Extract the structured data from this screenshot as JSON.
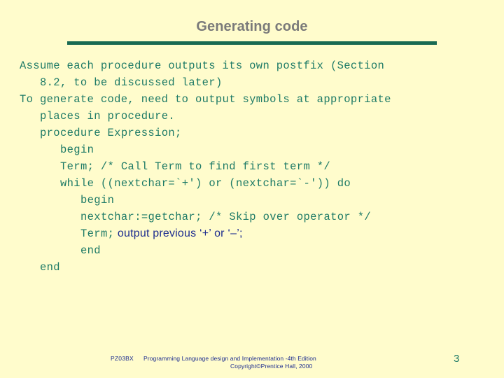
{
  "slide": {
    "title": "Generating code",
    "page_number": "3",
    "background_color": "#fffccc",
    "title_color": "#7a7a7a",
    "rule_color": "#186a52",
    "code_color": "#1d7a66",
    "accent_color": "#1d2d8f"
  },
  "body": {
    "lines": [
      {
        "indent": 0,
        "text": "Assume each procedure outputs its own postfix (Section"
      },
      {
        "indent": 1,
        "text": "8.2, to be discussed later)"
      },
      {
        "indent": 0,
        "text": "To generate code, need to output symbols at appropriate"
      },
      {
        "indent": 1,
        "text": "places in procedure."
      },
      {
        "indent": 1,
        "text": "procedure Expression;"
      },
      {
        "indent": 2,
        "text": "begin"
      },
      {
        "indent": 2,
        "text": "Term; /* Call Term to find first term */"
      },
      {
        "indent": 2,
        "text": "while ((nextchar=`+') or (nextchar=`-')) do"
      },
      {
        "indent": 3,
        "text": "begin"
      },
      {
        "indent": 3,
        "text": "nextchar:=getchar; /* Skip over operator */"
      },
      {
        "indent": 3,
        "text": "Term;",
        "text2": " output previous ‘+’ or ‘–’;"
      },
      {
        "indent": 3,
        "text": "end"
      },
      {
        "indent": 1,
        "text": "end"
      }
    ]
  },
  "footer": {
    "code": "PZ03BX",
    "title": "Programming Language design and Implementation -4th Edition",
    "copyright": "Copyright©Prentice Hall, 2000"
  }
}
